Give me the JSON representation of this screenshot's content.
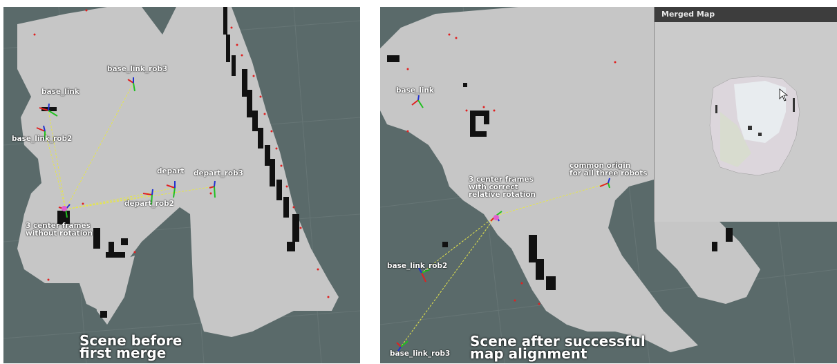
{
  "left_panel": {
    "frames": {
      "base_link_rob3": "base_link_rob3",
      "base_link": "base_link",
      "base_link_rob2": "base_link_rob2",
      "depart": "depart",
      "depart_rob3": "depart_rob3",
      "depart_rob2": "depart_rob2",
      "center_note": "3 center frames\nwithout rotation"
    },
    "caption": "Scene before\nfirst merge"
  },
  "right_panel": {
    "frames": {
      "base_link": "base_link",
      "base_link_rob2": "base_link_rob2",
      "base_link_rob3": "base_link_rob3",
      "center_note": "3 center frames\nwith correct\nrelative rotation",
      "origin_note": "common origin\nfor all three robots"
    },
    "caption": "Scene after successful\nmap alignment"
  },
  "merged_map": {
    "title": "Merged Map"
  },
  "colors": {
    "background": "#5a6a6a",
    "free_space": "#c6c6c6",
    "obstacle": "#111111",
    "laser_points": "#e02020",
    "tf_link": "#e6e64a"
  }
}
